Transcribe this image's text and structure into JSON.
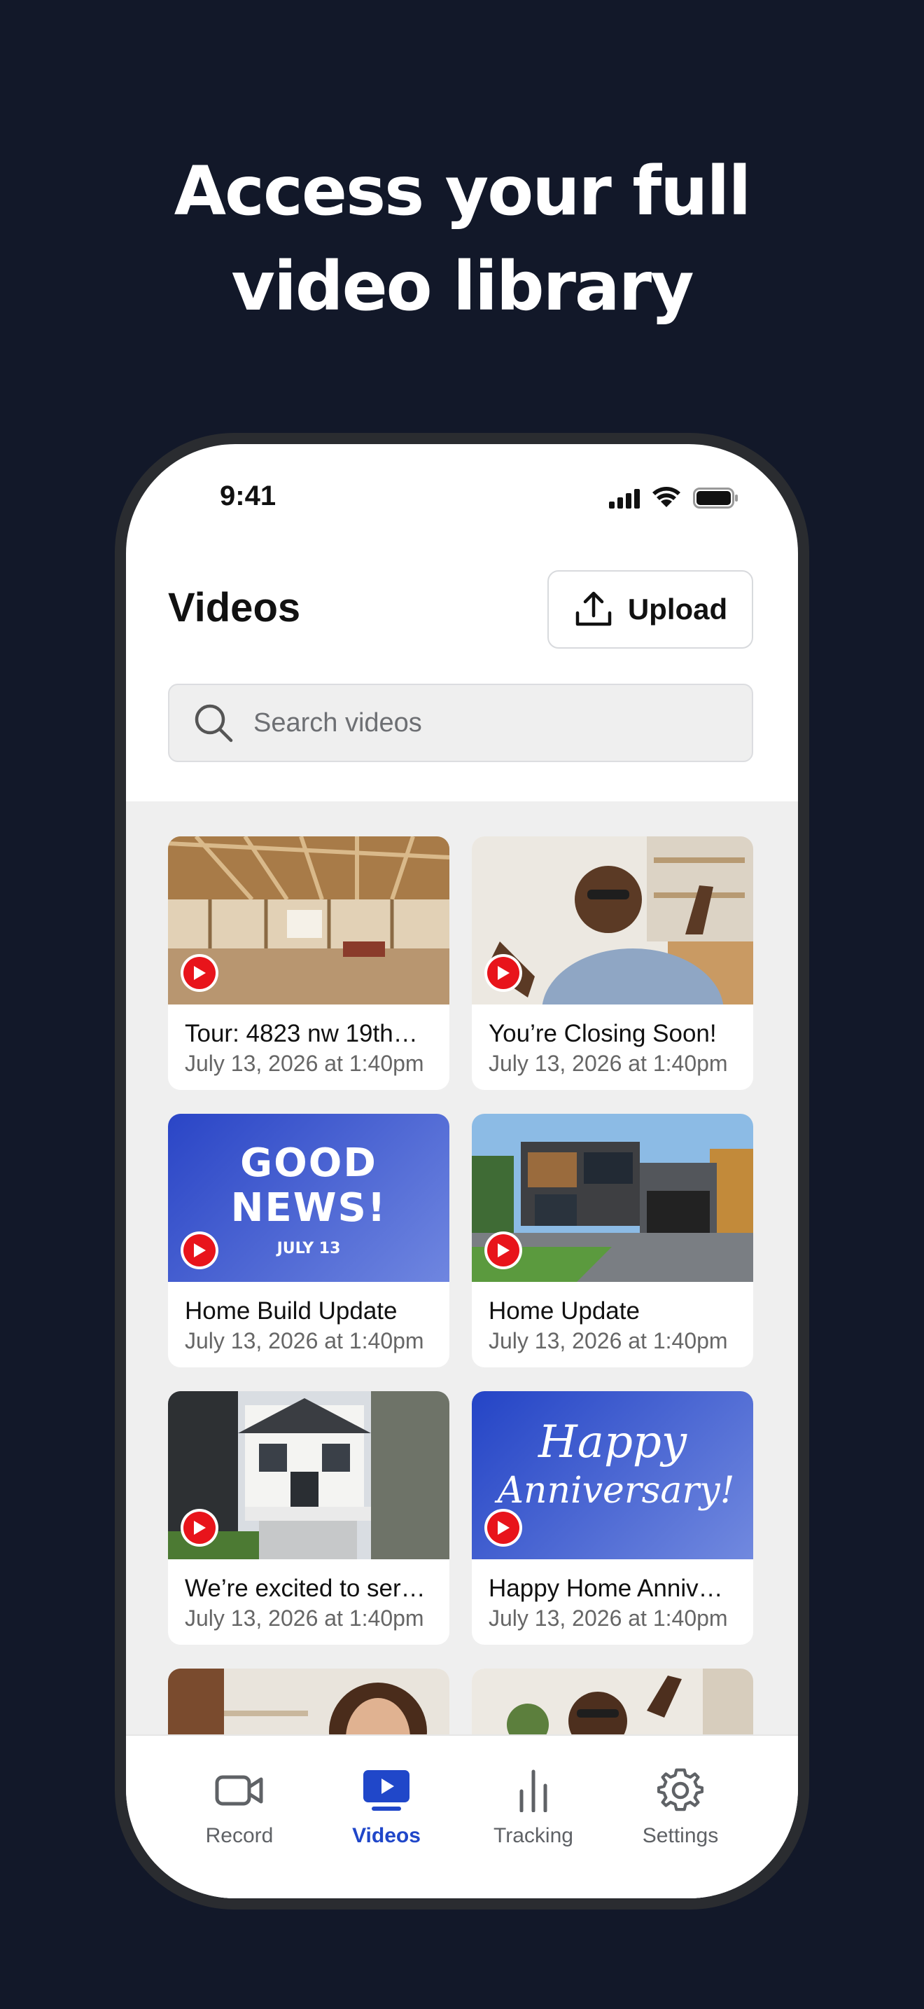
{
  "headline": {
    "line1": "Access your full",
    "line2": "video library"
  },
  "status_bar": {
    "time": "9:41"
  },
  "header": {
    "title": "Videos",
    "upload_label": "Upload"
  },
  "search": {
    "placeholder": "Search videos"
  },
  "videos": [
    {
      "title": "Tour: 4823 nw 19th…",
      "date": "July 13, 2026 at 1:40pm",
      "thumbnail": "unfinished house interior framing"
    },
    {
      "title": "You’re Closing Soon!",
      "date": "July 13, 2026 at 1:40pm",
      "thumbnail": "smiling man waving selfie"
    },
    {
      "title": "Home Build Update",
      "date": "July 13, 2026 at 1:40pm",
      "thumbnail_text": {
        "line1": "GOOD",
        "line2": "NEWS!",
        "line3": "JULY 13"
      }
    },
    {
      "title": "Home Update",
      "date": "July 13, 2026 at 1:40pm",
      "thumbnail": "modern house exterior"
    },
    {
      "title": "We’re excited to ser…",
      "date": "July 13, 2026 at 1:40pm",
      "thumbnail": "white house front porch"
    },
    {
      "title": "Happy Home Anniv…",
      "date": "July 13, 2026 at 1:40pm",
      "thumbnail_text": {
        "line1": "Happy",
        "line2": "Anniversary!"
      }
    },
    {
      "title": "",
      "date": "",
      "thumbnail": "smiling woman"
    },
    {
      "title": "",
      "date": "",
      "thumbnail": "smiling man waving"
    }
  ],
  "tabs": [
    {
      "label": "Record",
      "icon": "video-camera-icon"
    },
    {
      "label": "Videos",
      "icon": "play-screen-icon",
      "active": true
    },
    {
      "label": "Tracking",
      "icon": "bar-chart-icon"
    },
    {
      "label": "Settings",
      "icon": "gear-icon"
    }
  ],
  "colors": {
    "background": "#121829",
    "accent": "#2047c9",
    "play_red": "#e8141b",
    "promo_blue": "#2b48c7"
  }
}
